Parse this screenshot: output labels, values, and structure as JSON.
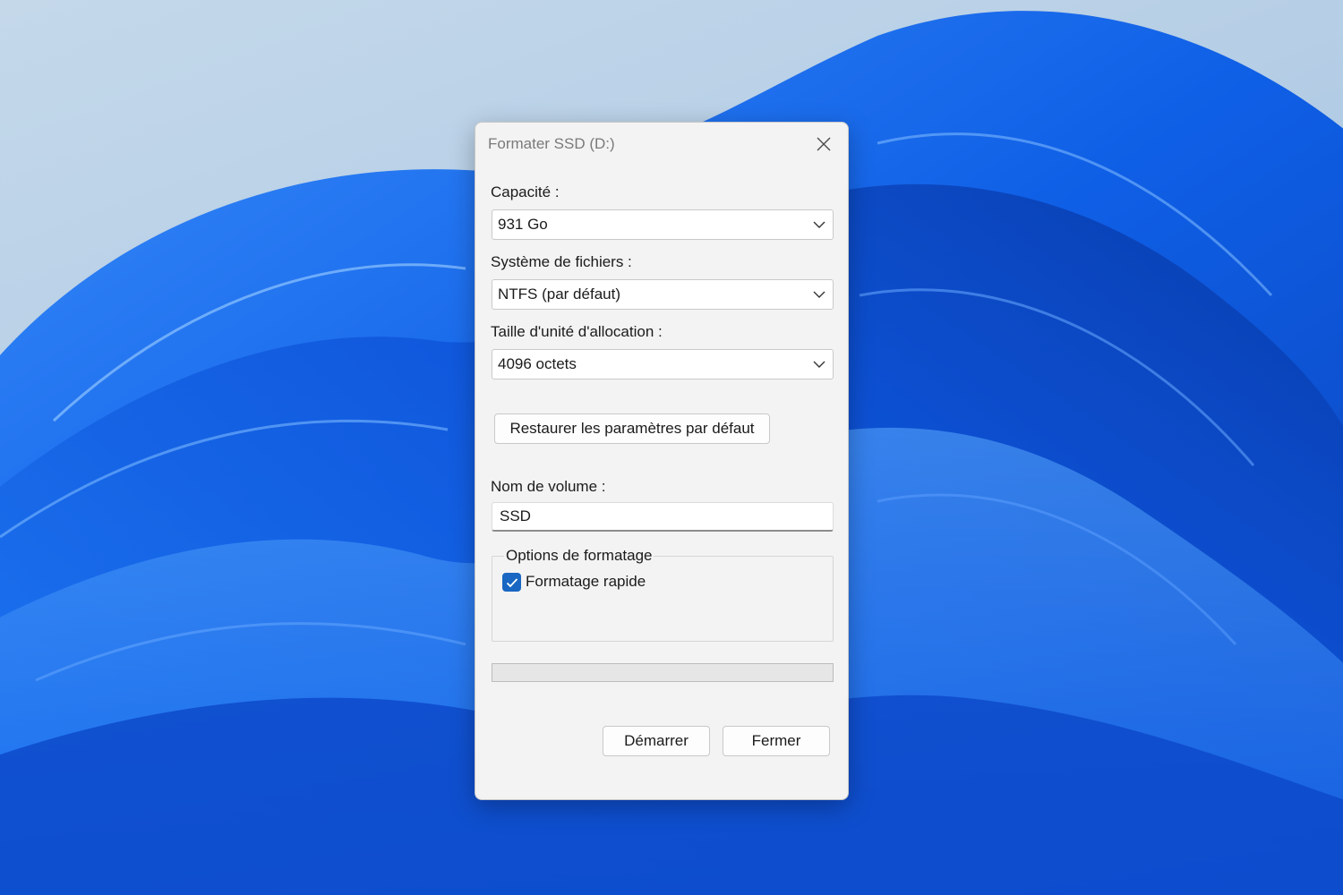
{
  "dialog": {
    "title": "Formater SSD (D:)",
    "capacity": {
      "label": "Capacité :",
      "value": "931 Go"
    },
    "file_system": {
      "label": "Système de fichiers :",
      "value": "NTFS (par défaut)"
    },
    "allocation_size": {
      "label": "Taille d'unité d'allocation :",
      "value": "4096 octets"
    },
    "restore_defaults_label": "Restaurer les paramètres par défaut",
    "volume_name": {
      "label": "Nom de volume :",
      "value": "SSD"
    },
    "format_options": {
      "legend": "Options de formatage",
      "quick_format": {
        "label": "Formatage rapide",
        "checked": true
      }
    },
    "progress": 0,
    "buttons": {
      "start_label": "Démarrer",
      "close_label": "Fermer"
    }
  },
  "colors": {
    "accent": "#1967c2",
    "wallpaper_blue": "#0a5fe0",
    "dialog_bg": "#f3f3f3"
  }
}
